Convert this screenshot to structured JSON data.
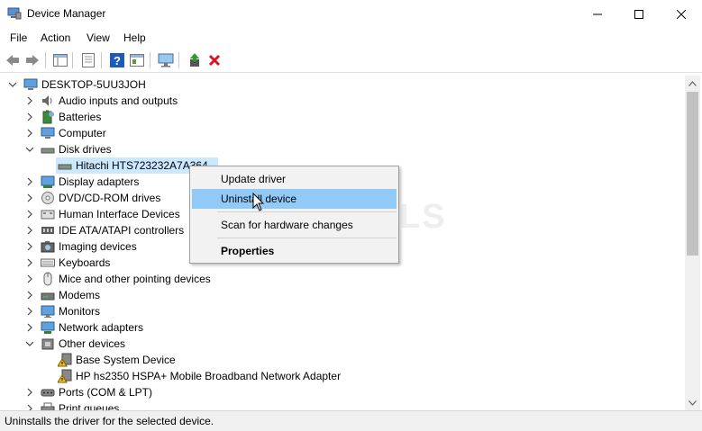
{
  "window": {
    "title": "Device Manager"
  },
  "menu": [
    "File",
    "Action",
    "View",
    "Help"
  ],
  "tree": {
    "root": "DESKTOP-5UU3JOH",
    "items": [
      {
        "label": "Audio inputs and outputs",
        "icon": "speaker-icon",
        "expanded": false
      },
      {
        "label": "Batteries",
        "icon": "battery-icon",
        "expanded": false
      },
      {
        "label": "Computer",
        "icon": "computer-icon",
        "expanded": false
      },
      {
        "label": "Disk drives",
        "icon": "disk-drive-icon",
        "expanded": true
      },
      {
        "label": "Hitachi HTS723232A7A364",
        "icon": "disk-drive-icon",
        "child": true,
        "selected": true
      },
      {
        "label": "Display adapters",
        "icon": "display-adapter-icon",
        "expanded": false
      },
      {
        "label": "DVD/CD-ROM drives",
        "icon": "dvd-drive-icon",
        "expanded": false
      },
      {
        "label": "Human Interface Devices",
        "icon": "hid-icon",
        "expanded": false
      },
      {
        "label": "IDE ATA/ATAPI controllers",
        "icon": "ide-controller-icon",
        "expanded": false
      },
      {
        "label": "Imaging devices",
        "icon": "camera-icon",
        "expanded": false
      },
      {
        "label": "Keyboards",
        "icon": "keyboard-icon",
        "expanded": false
      },
      {
        "label": "Mice and other pointing devices",
        "icon": "mouse-icon",
        "expanded": false
      },
      {
        "label": "Modems",
        "icon": "modem-icon",
        "expanded": false
      },
      {
        "label": "Monitors",
        "icon": "monitor-icon",
        "expanded": false
      },
      {
        "label": "Network adapters",
        "icon": "network-adapter-icon",
        "expanded": false
      },
      {
        "label": "Other devices",
        "icon": "other-devices-icon",
        "expanded": true
      },
      {
        "label": "Base System Device",
        "icon": "warning-device-icon",
        "child": true
      },
      {
        "label": "HP hs2350 HSPA+ Mobile Broadband Network Adapter",
        "icon": "warning-device-icon",
        "child": true
      },
      {
        "label": "Ports (COM & LPT)",
        "icon": "port-icon",
        "expanded": false
      },
      {
        "label": "Print queues",
        "icon": "printer-icon",
        "expanded": false
      }
    ]
  },
  "context_menu": {
    "items": [
      "Update driver",
      "Uninstall device",
      "Scan for hardware changes",
      "Properties"
    ],
    "highlighted": "Uninstall device"
  },
  "status": "Uninstalls the driver for the selected device.",
  "watermark": "APPUALS",
  "colors": {
    "selection": "#cce8ff",
    "menu_highlight": "#91c9f7",
    "delete_red": "#d9141c",
    "help_blue": "#1e5bb8"
  }
}
